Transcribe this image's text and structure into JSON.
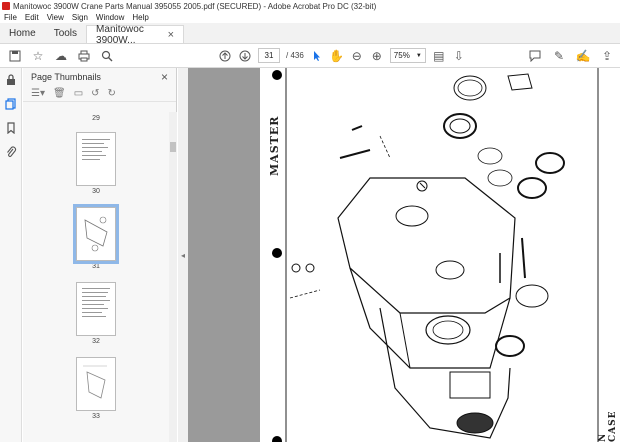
{
  "window": {
    "title": "Manitowoc 3900W Crane Parts Manual 395055 2005.pdf (SECURED) - Adobe Acrobat Pro DC (32-bit)"
  },
  "menu": [
    "File",
    "Edit",
    "View",
    "Sign",
    "Window",
    "Help"
  ],
  "tabs": {
    "home": "Home",
    "tools": "Tools",
    "document": "Manitowoc 3900W...",
    "close": "×"
  },
  "toolbar": {
    "page_current": "31",
    "page_total": "/ 436",
    "zoom": "75%"
  },
  "panel": {
    "title": "Page Thumbnails",
    "close": "×"
  },
  "thumbnails": [
    {
      "label": "29"
    },
    {
      "label": "30"
    },
    {
      "label": "31",
      "selected": true
    },
    {
      "label": "32"
    },
    {
      "label": "33"
    }
  ],
  "document": {
    "side_text": "MASTER",
    "corner_text": "N CASE"
  }
}
